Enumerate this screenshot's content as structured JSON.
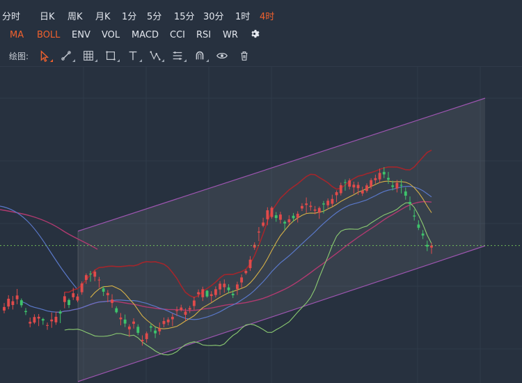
{
  "toolbar": {
    "periods": [
      {
        "label": "分时",
        "active": false
      },
      {
        "label": "日K",
        "active": false
      },
      {
        "label": "周K",
        "active": false
      },
      {
        "label": "月K",
        "active": false
      },
      {
        "label": "1分",
        "active": false
      },
      {
        "label": "5分",
        "active": false
      },
      {
        "label": "15分",
        "active": false
      },
      {
        "label": "30分",
        "active": false
      },
      {
        "label": "1时",
        "active": false
      },
      {
        "label": "4时",
        "active": true
      }
    ],
    "indicators": [
      {
        "label": "MA",
        "active": true
      },
      {
        "label": "BOLL",
        "active": true
      },
      {
        "label": "ENV",
        "active": false
      },
      {
        "label": "VOL",
        "active": false
      },
      {
        "label": "MACD",
        "active": false
      },
      {
        "label": "CCI",
        "active": false
      },
      {
        "label": "RSI",
        "active": false
      },
      {
        "label": "WR",
        "active": false
      }
    ],
    "settings_icon": "gear-icon",
    "draw_label": "绘图:",
    "draw_tools": [
      {
        "icon": "cursor-icon",
        "active": true
      },
      {
        "icon": "trend-line-icon",
        "active": false
      },
      {
        "icon": "grid-icon",
        "active": false
      },
      {
        "icon": "rectangle-icon",
        "active": false
      },
      {
        "icon": "text-icon",
        "active": false
      },
      {
        "icon": "pattern-icon",
        "active": false
      },
      {
        "icon": "fibonacci-icon",
        "active": false
      },
      {
        "icon": "magnet-icon",
        "active": false
      },
      {
        "icon": "eye-icon",
        "active": false
      },
      {
        "icon": "trash-icon",
        "active": false
      }
    ]
  },
  "colors": {
    "background": "#27313f",
    "up": "#e04b4b",
    "down": "#3ec36b",
    "active": "#f0612e",
    "boll_upper": "#a3262c",
    "boll_mid": "#b13a70",
    "boll_lower": "#8ccc72",
    "ma_blue": "#5a78c9",
    "ma_yellow": "#d6b148",
    "channel_line": "#9d55b0",
    "current_price_line": "#7fd35c"
  },
  "chart_data": {
    "type": "candlestick",
    "indicators": [
      "MA",
      "BOLL"
    ],
    "y_range": [
      0,
      100
    ],
    "candles": [
      [
        27.8,
        30.8,
        29.2,
        26.7
      ],
      [
        29.4,
        33.9,
        32.5,
        28.3
      ],
      [
        30.0,
        33.6,
        31.5,
        28.2
      ],
      [
        32.3,
        36.4,
        33.8,
        30.3
      ],
      [
        31.9,
        32.6,
        29.9,
        29.0
      ],
      [
        27.6,
        28.8,
        27.2,
        26.0
      ],
      [
        22.6,
        25.0,
        23.3,
        21.1
      ],
      [
        23.0,
        26.3,
        25.2,
        22.4
      ],
      [
        24.6,
        26.4,
        25.3,
        21.6
      ],
      [
        24.4,
        24.9,
        23.8,
        22.1
      ],
      [
        21.7,
        23.0,
        22.0,
        20.1
      ],
      [
        23.5,
        27.0,
        24.2,
        20.9
      ],
      [
        23.1,
        27.3,
        25.3,
        22.1
      ],
      [
        27.4,
        28.0,
        26.6,
        22.8
      ],
      [
        31.2,
        35.2,
        33.5,
        28.7
      ],
      [
        32.0,
        32.6,
        30.0,
        28.8
      ],
      [
        33.1,
        36.9,
        34.7,
        32.0
      ],
      [
        31.8,
        34.5,
        33.4,
        31.1
      ],
      [
        35.1,
        39.4,
        38.6,
        34.1
      ],
      [
        40.0,
        42.6,
        41.9,
        38.4
      ],
      [
        42.5,
        43.6,
        42.2,
        39.3
      ],
      [
        41.3,
        44.0,
        43.3,
        39.5
      ],
      [
        39.9,
        41.2,
        40.1,
        36.9
      ],
      [
        36.6,
        37.5,
        35.3,
        33.6
      ],
      [
        33.9,
        36.0,
        34.8,
        31.1
      ],
      [
        30.8,
        34.3,
        32.2,
        28.9
      ],
      [
        28.7,
        29.5,
        27.1,
        26.6
      ],
      [
        24.3,
        26.8,
        25.0,
        21.9
      ],
      [
        24.2,
        26.2,
        22.6,
        21.2
      ],
      [
        20.3,
        22.3,
        21.4,
        17.3
      ],
      [
        22.5,
        24.7,
        23.4,
        20.6
      ],
      [
        21.3,
        22.3,
        18.9,
        18.0
      ],
      [
        15.5,
        17.9,
        16.1,
        13.8
      ],
      [
        16.4,
        19.4,
        18.7,
        15.0
      ],
      [
        21.5,
        22.7,
        21.0,
        19.3
      ],
      [
        19.8,
        21.6,
        18.7,
        16.8
      ],
      [
        19.5,
        23.0,
        20.6,
        18.1
      ],
      [
        22.4,
        25.0,
        23.6,
        21.1
      ],
      [
        23.1,
        25.1,
        24.2,
        21.9
      ],
      [
        24.3,
        26.6,
        25.3,
        21.6
      ],
      [
        27.6,
        29.4,
        27.9,
        25.6
      ],
      [
        28.0,
        30.1,
        29.0,
        27.4
      ],
      [
        26.1,
        28.7,
        27.4,
        23.7
      ],
      [
        28.2,
        29.7,
        28.8,
        26.8
      ],
      [
        29.6,
        33.3,
        31.8,
        28.0
      ],
      [
        34.3,
        36.2,
        35.1,
        33.0
      ],
      [
        33.1,
        37.3,
        36.3,
        31.6
      ],
      [
        35.7,
        36.0,
        33.4,
        32.9
      ],
      [
        33.6,
        35.5,
        34.3,
        31.2
      ],
      [
        34.0,
        37.4,
        36.3,
        33.0
      ],
      [
        36.2,
        39.5,
        38.5,
        34.0
      ],
      [
        37.1,
        40.2,
        38.5,
        34.9
      ],
      [
        37.0,
        38.3,
        35.9,
        34.6
      ],
      [
        34.5,
        35.9,
        33.9,
        32.8
      ],
      [
        36.4,
        39.3,
        38.2,
        34.0
      ],
      [
        39.0,
        42.2,
        41.0,
        36.9
      ],
      [
        42.7,
        44.2,
        43.6,
        42.1
      ],
      [
        44.7,
        49.5,
        48.1,
        43.6
      ],
      [
        52.9,
        55.0,
        54.0,
        52.0
      ],
      [
        58.9,
        61.1,
        59.3,
        55.5
      ],
      [
        61.6,
        64.8,
        62.9,
        61.0
      ],
      [
        64.2,
        69.0,
        67.8,
        61.8
      ],
      [
        65.1,
        69.4,
        68.8,
        64.4
      ],
      [
        65.8,
        67.1,
        64.7,
        63.2
      ],
      [
        64.0,
        67.2,
        66.1,
        62.5
      ],
      [
        63.2,
        63.8,
        62.5,
        59.9
      ],
      [
        63.0,
        65.8,
        64.2,
        62.0
      ],
      [
        65.6,
        66.7,
        64.6,
        63.2
      ],
      [
        64.8,
        67.4,
        66.4,
        62.9
      ],
      [
        68.5,
        70.6,
        69.5,
        67.5
      ],
      [
        69.9,
        72.9,
        70.5,
        66.7
      ],
      [
        69.1,
        71.3,
        69.6,
        67.6
      ],
      [
        67.6,
        69.5,
        68.1,
        66.2
      ],
      [
        66.8,
        69.3,
        68.7,
        64.4
      ],
      [
        70.5,
        71.5,
        70.1,
        66.5
      ],
      [
        69.8,
        72.5,
        71.6,
        68.7
      ],
      [
        70.4,
        74.0,
        72.3,
        69.3
      ],
      [
        73.8,
        75.7,
        75.0,
        71.0
      ],
      [
        74.6,
        78.8,
        77.8,
        73.7
      ],
      [
        79.0,
        80.1,
        78.8,
        75.6
      ],
      [
        77.2,
        80.5,
        79.7,
        76.1
      ],
      [
        76.9,
        79.2,
        78.0,
        74.4
      ],
      [
        76.6,
        79.1,
        77.9,
        73.9
      ],
      [
        74.5,
        77.2,
        75.6,
        73.5
      ],
      [
        75.5,
        78.5,
        77.7,
        74.8
      ],
      [
        77.3,
        80.6,
        79.8,
        76.2
      ],
      [
        79.8,
        82.0,
        80.6,
        78.4
      ],
      [
        80.1,
        84.4,
        82.7,
        78.7
      ],
      [
        83.1,
        85.0,
        82.1,
        80.6
      ],
      [
        80.7,
        83.1,
        80.0,
        78.3
      ],
      [
        77.7,
        79.6,
        77.1,
        75.7
      ],
      [
        76.5,
        79.9,
        78.7,
        74.9
      ],
      [
        77.9,
        80.1,
        77.7,
        74.5
      ],
      [
        75.3,
        76.9,
        73.6,
        72.0
      ],
      [
        71.1,
        73.3,
        70.3,
        67.8
      ],
      [
        65.7,
        68.1,
        65.3,
        63.7
      ],
      [
        62.1,
        63.8,
        60.8,
        59.9
      ],
      [
        58.5,
        59.9,
        57.7,
        56.3
      ],
      [
        54.0,
        55.7,
        53.3,
        51.5
      ],
      [
        52.9,
        54.8,
        53.7,
        50.4
      ]
    ]
  }
}
